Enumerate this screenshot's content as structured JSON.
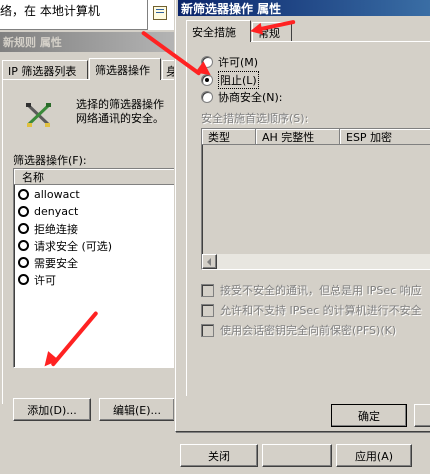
{
  "background_window": {
    "location_text": "络，在 本地计算机",
    "doc_icon": "document-icon"
  },
  "rule_dialog": {
    "title": "新规则 属性",
    "tabs": [
      {
        "label": "IP 筛选器列表",
        "active": false
      },
      {
        "label": "筛选器操作",
        "active": true
      },
      {
        "label": "身",
        "active": false
      }
    ],
    "description": "选择的筛选器操作指定了是否此规则协商和如何协商网络通讯的安全。",
    "description_line1": "选择的筛选器操作",
    "description_line2": "网络通讯的安全。",
    "filter_actions_label": "筛选器操作(F):",
    "list_header": "名称",
    "list_items": [
      {
        "label": "allowact"
      },
      {
        "label": "denyact"
      },
      {
        "label": "拒绝连接"
      },
      {
        "label": "请求安全 (可选)"
      },
      {
        "label": "需要安全"
      },
      {
        "label": "许可"
      }
    ],
    "add_button": "添加(D)...",
    "edit_button": "编辑(E)...",
    "close_button": "关闭",
    "apply_button": "应用(A)"
  },
  "action_dialog": {
    "title": "新筛选器操作 属性",
    "tabs": [
      {
        "label": "安全措施",
        "active": true
      },
      {
        "label": "常规",
        "active": false
      }
    ],
    "radios": [
      {
        "label": "许可(M)",
        "selected": false
      },
      {
        "label": "阻止(L)",
        "selected": true
      },
      {
        "label": "协商安全(N):",
        "selected": false
      }
    ],
    "preference_label": "安全措施首选顺序(S):",
    "table_headers": [
      "类型",
      "AH 完整性",
      "ESP 加密"
    ],
    "checkboxes": [
      {
        "label": "接受不安全的通讯，但总是用 IPSec 响应",
        "checked": false
      },
      {
        "label": "允许和不支持 IPSec 的计算机进行不安全",
        "checked": false
      },
      {
        "label": "使用会话密钥完全向前保密(PFS)(K)",
        "checked": false
      }
    ],
    "ok_button": "确定"
  },
  "annotation_color": "#ff2222"
}
